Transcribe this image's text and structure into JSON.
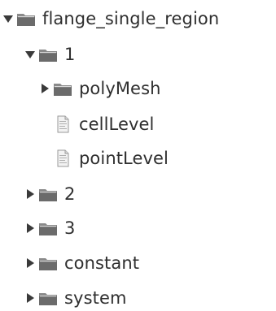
{
  "tree": {
    "items": [
      {
        "label": "flange_single_region",
        "kind": "folder",
        "expander": "expanded",
        "expander_icon": "triangle-down-icon",
        "icon": "folder-icon"
      },
      {
        "label": "1",
        "kind": "folder",
        "expander": "expanded",
        "expander_icon": "triangle-down-icon",
        "icon": "folder-icon"
      },
      {
        "label": "polyMesh",
        "kind": "folder",
        "expander": "collapsed",
        "expander_icon": "triangle-right-icon",
        "icon": "folder-icon"
      },
      {
        "label": "cellLevel",
        "kind": "file",
        "expander": "none",
        "icon": "text-file-icon"
      },
      {
        "label": "pointLevel",
        "kind": "file",
        "expander": "none",
        "icon": "text-file-icon"
      },
      {
        "label": "2",
        "kind": "folder",
        "expander": "collapsed",
        "expander_icon": "triangle-right-icon",
        "icon": "folder-icon"
      },
      {
        "label": "3",
        "kind": "folder",
        "expander": "collapsed",
        "expander_icon": "triangle-right-icon",
        "icon": "folder-icon"
      },
      {
        "label": "constant",
        "kind": "folder",
        "expander": "collapsed",
        "expander_icon": "triangle-right-icon",
        "icon": "folder-icon"
      },
      {
        "label": "system",
        "kind": "folder",
        "expander": "collapsed",
        "expander_icon": "triangle-right-icon",
        "icon": "folder-icon"
      }
    ]
  },
  "colors": {
    "text": "#2f2f2f",
    "expander": "#3a3a3a",
    "folder_body": "#6b6b6b",
    "folder_tab": "#8a8a8a",
    "file_page": "#f2f2f2",
    "file_border": "#9a9a9a",
    "file_lines": "#b0b0b0"
  }
}
